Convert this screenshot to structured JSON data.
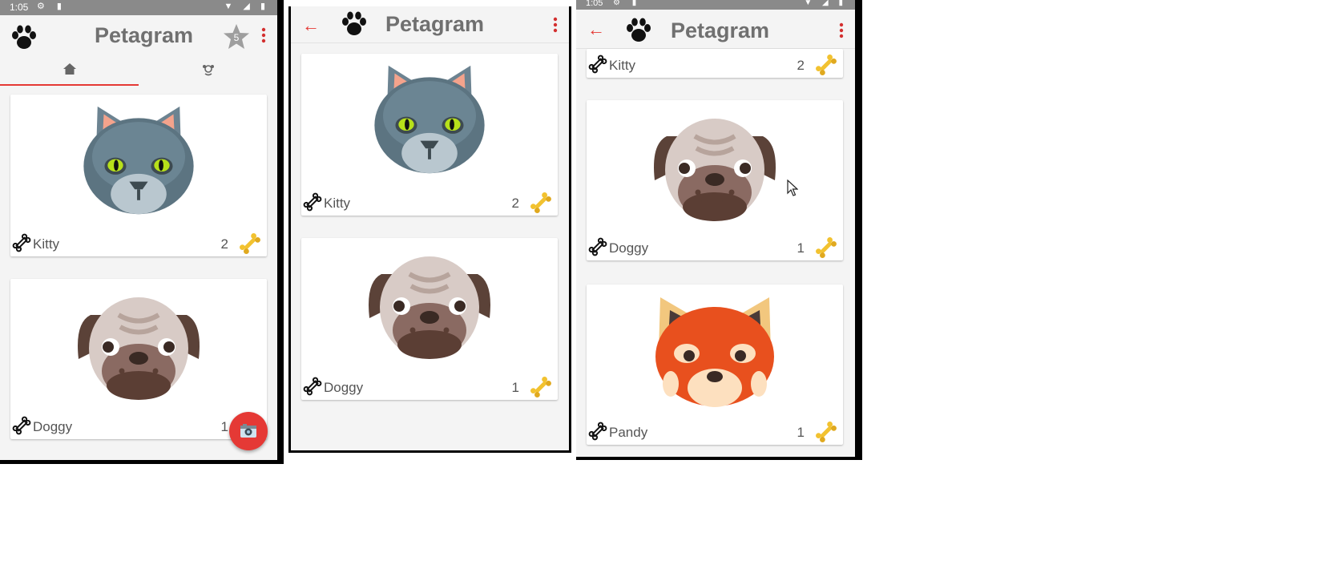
{
  "colors": {
    "accent": "#e53935",
    "statusbar": "#8a8a8a",
    "title": "#707070",
    "bone": "#f2c230"
  },
  "screen1": {
    "status_time": "1:05",
    "title": "Petagram",
    "fav_badge_count": "5",
    "tabs": [
      {
        "icon": "home-icon",
        "active": true
      },
      {
        "icon": "dog-face-icon",
        "active": false
      }
    ],
    "cards": [
      {
        "name": "Kitty",
        "likes": "2",
        "pet": "cat"
      },
      {
        "name": "Doggy",
        "likes": "1",
        "pet": "pug"
      }
    ],
    "fab_icon": "camera-icon"
  },
  "screen2": {
    "title": "Petagram",
    "cards": [
      {
        "name": "Kitty",
        "likes": "2",
        "pet": "cat"
      },
      {
        "name": "Doggy",
        "likes": "1",
        "pet": "pug"
      }
    ]
  },
  "screen3": {
    "status_time": "1:05",
    "title": "Petagram",
    "cards": [
      {
        "name": "Kitty",
        "likes": "2",
        "pet": "cat"
      },
      {
        "name": "Doggy",
        "likes": "1",
        "pet": "pug"
      },
      {
        "name": "Pandy",
        "likes": "1",
        "pet": "red-panda"
      }
    ]
  }
}
